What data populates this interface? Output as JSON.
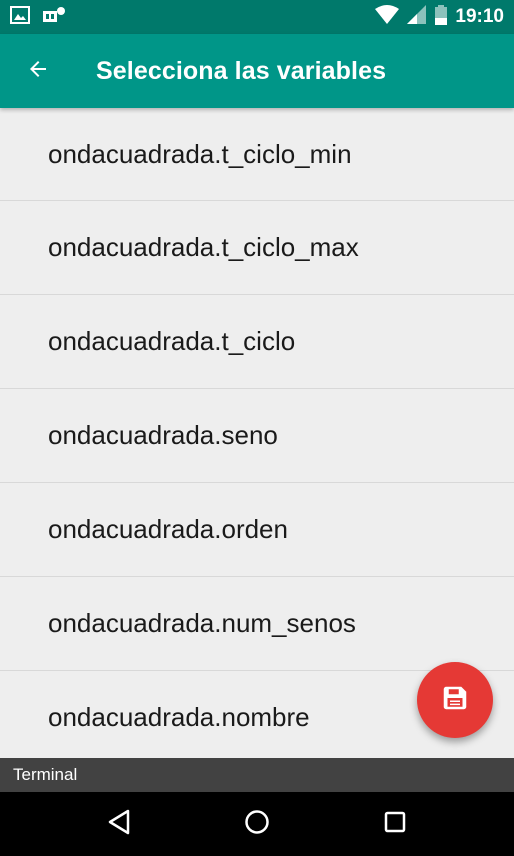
{
  "status_bar": {
    "time": "19:10",
    "icons": [
      "image-icon",
      "notification-icon",
      "wifi-icon",
      "signal-icon",
      "battery-icon"
    ]
  },
  "app_bar": {
    "title": "Selecciona las variables",
    "back_icon": "arrow-back-icon"
  },
  "list": {
    "items": [
      {
        "label": "ondacuadrada.t_ciclo_min"
      },
      {
        "label": "ondacuadrada.t_ciclo_max"
      },
      {
        "label": "ondacuadrada.t_ciclo"
      },
      {
        "label": "ondacuadrada.seno"
      },
      {
        "label": "ondacuadrada.orden"
      },
      {
        "label": "ondacuadrada.num_senos"
      },
      {
        "label": "ondacuadrada.nombre"
      }
    ]
  },
  "fab": {
    "icon": "save-icon"
  },
  "terminal": {
    "label": "Terminal"
  },
  "nav": {
    "buttons": [
      "back-triangle-icon",
      "home-circle-icon",
      "recents-square-icon"
    ]
  },
  "colors": {
    "status_bar": "#00796b",
    "app_bar": "#009688",
    "fab": "#e53935",
    "background": "#eeeeee",
    "terminal": "#424242"
  }
}
